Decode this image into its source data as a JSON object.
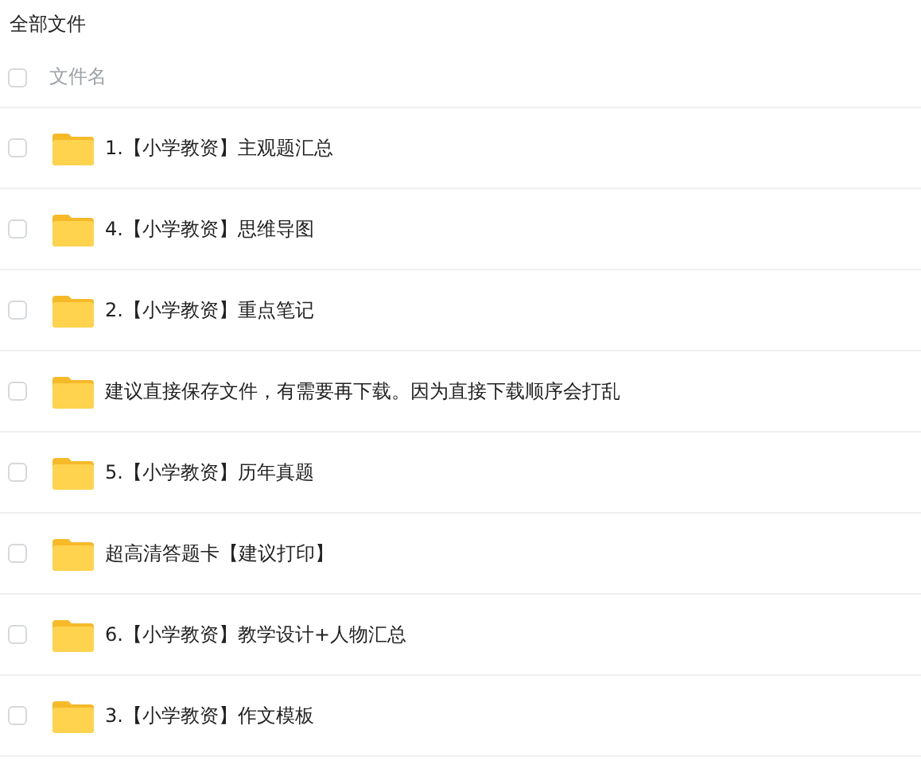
{
  "title": "全部文件",
  "header": {
    "label": "文件名",
    "checked": false
  },
  "files": [
    {
      "name": "1.【小学教资】主观题汇总",
      "checked": false
    },
    {
      "name": "4.【小学教资】思维导图",
      "checked": false
    },
    {
      "name": "2.【小学教资】重点笔记",
      "checked": false
    },
    {
      "name": "建议直接保存文件，有需要再下载。因为直接下载顺序会打乱",
      "checked": false
    },
    {
      "name": "5.【小学教资】历年真题",
      "checked": false
    },
    {
      "name": "超高清答题卡【建议打印】",
      "checked": false
    },
    {
      "name": "6.【小学教资】教学设计+人物汇总",
      "checked": false
    },
    {
      "name": "3.【小学教资】作文模板",
      "checked": false
    }
  ]
}
